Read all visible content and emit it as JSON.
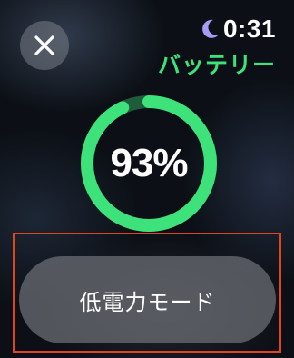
{
  "status_bar": {
    "moon_icon": "moon-icon",
    "time": "0:31"
  },
  "header": {
    "title": "バッテリー",
    "close_icon": "close-icon"
  },
  "battery": {
    "percent_text": "93%",
    "level": 0.93,
    "ring_color": "#3ee27a",
    "ring_track_color": "#1f5c3a"
  },
  "low_power": {
    "label": "低電力モード"
  },
  "colors": {
    "accent_green": "#3ee27a",
    "highlight_border": "#e0451f",
    "moon": "#a79cf5"
  }
}
